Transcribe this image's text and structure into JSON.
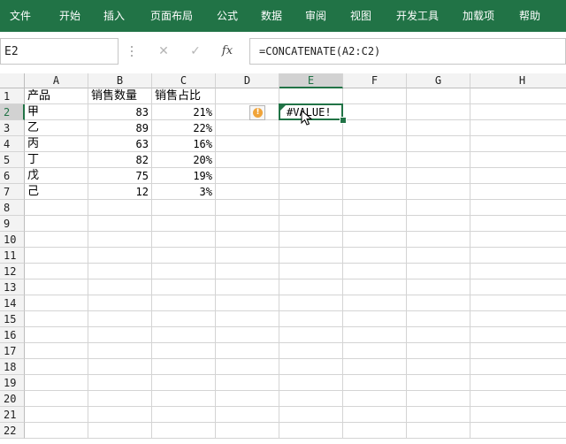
{
  "ribbon": {
    "tabs": [
      "文件",
      "开始",
      "插入",
      "页面布局",
      "公式",
      "数据",
      "审阅",
      "视图",
      "开发工具",
      "加载项",
      "帮助"
    ]
  },
  "formula_bar": {
    "name_box": "E2",
    "cancel_icon": "✕",
    "enter_icon": "✓",
    "fx_label": "fx",
    "formula": "=CONCATENATE(A2:C2)"
  },
  "sheet": {
    "columns": [
      "A",
      "B",
      "C",
      "D",
      "E",
      "F",
      "G",
      "H"
    ],
    "selected_column": "E",
    "rows": [
      "1",
      "2",
      "3",
      "4",
      "5",
      "6",
      "7",
      "8",
      "9",
      "10",
      "11",
      "12",
      "13",
      "14",
      "15",
      "16",
      "17",
      "18",
      "19",
      "20",
      "21",
      "22"
    ],
    "selected_row": "2",
    "header_row": [
      "产品",
      "销售数量",
      "销售占比"
    ],
    "data": [
      [
        "甲",
        "83",
        "21%"
      ],
      [
        "乙",
        "89",
        "22%"
      ],
      [
        "丙",
        "63",
        "16%"
      ],
      [
        "丁",
        "82",
        "20%"
      ],
      [
        "戊",
        "75",
        "19%"
      ],
      [
        "己",
        "12",
        "3%"
      ]
    ],
    "e2_value": "#VALUE!",
    "warning_icon": "!"
  }
}
